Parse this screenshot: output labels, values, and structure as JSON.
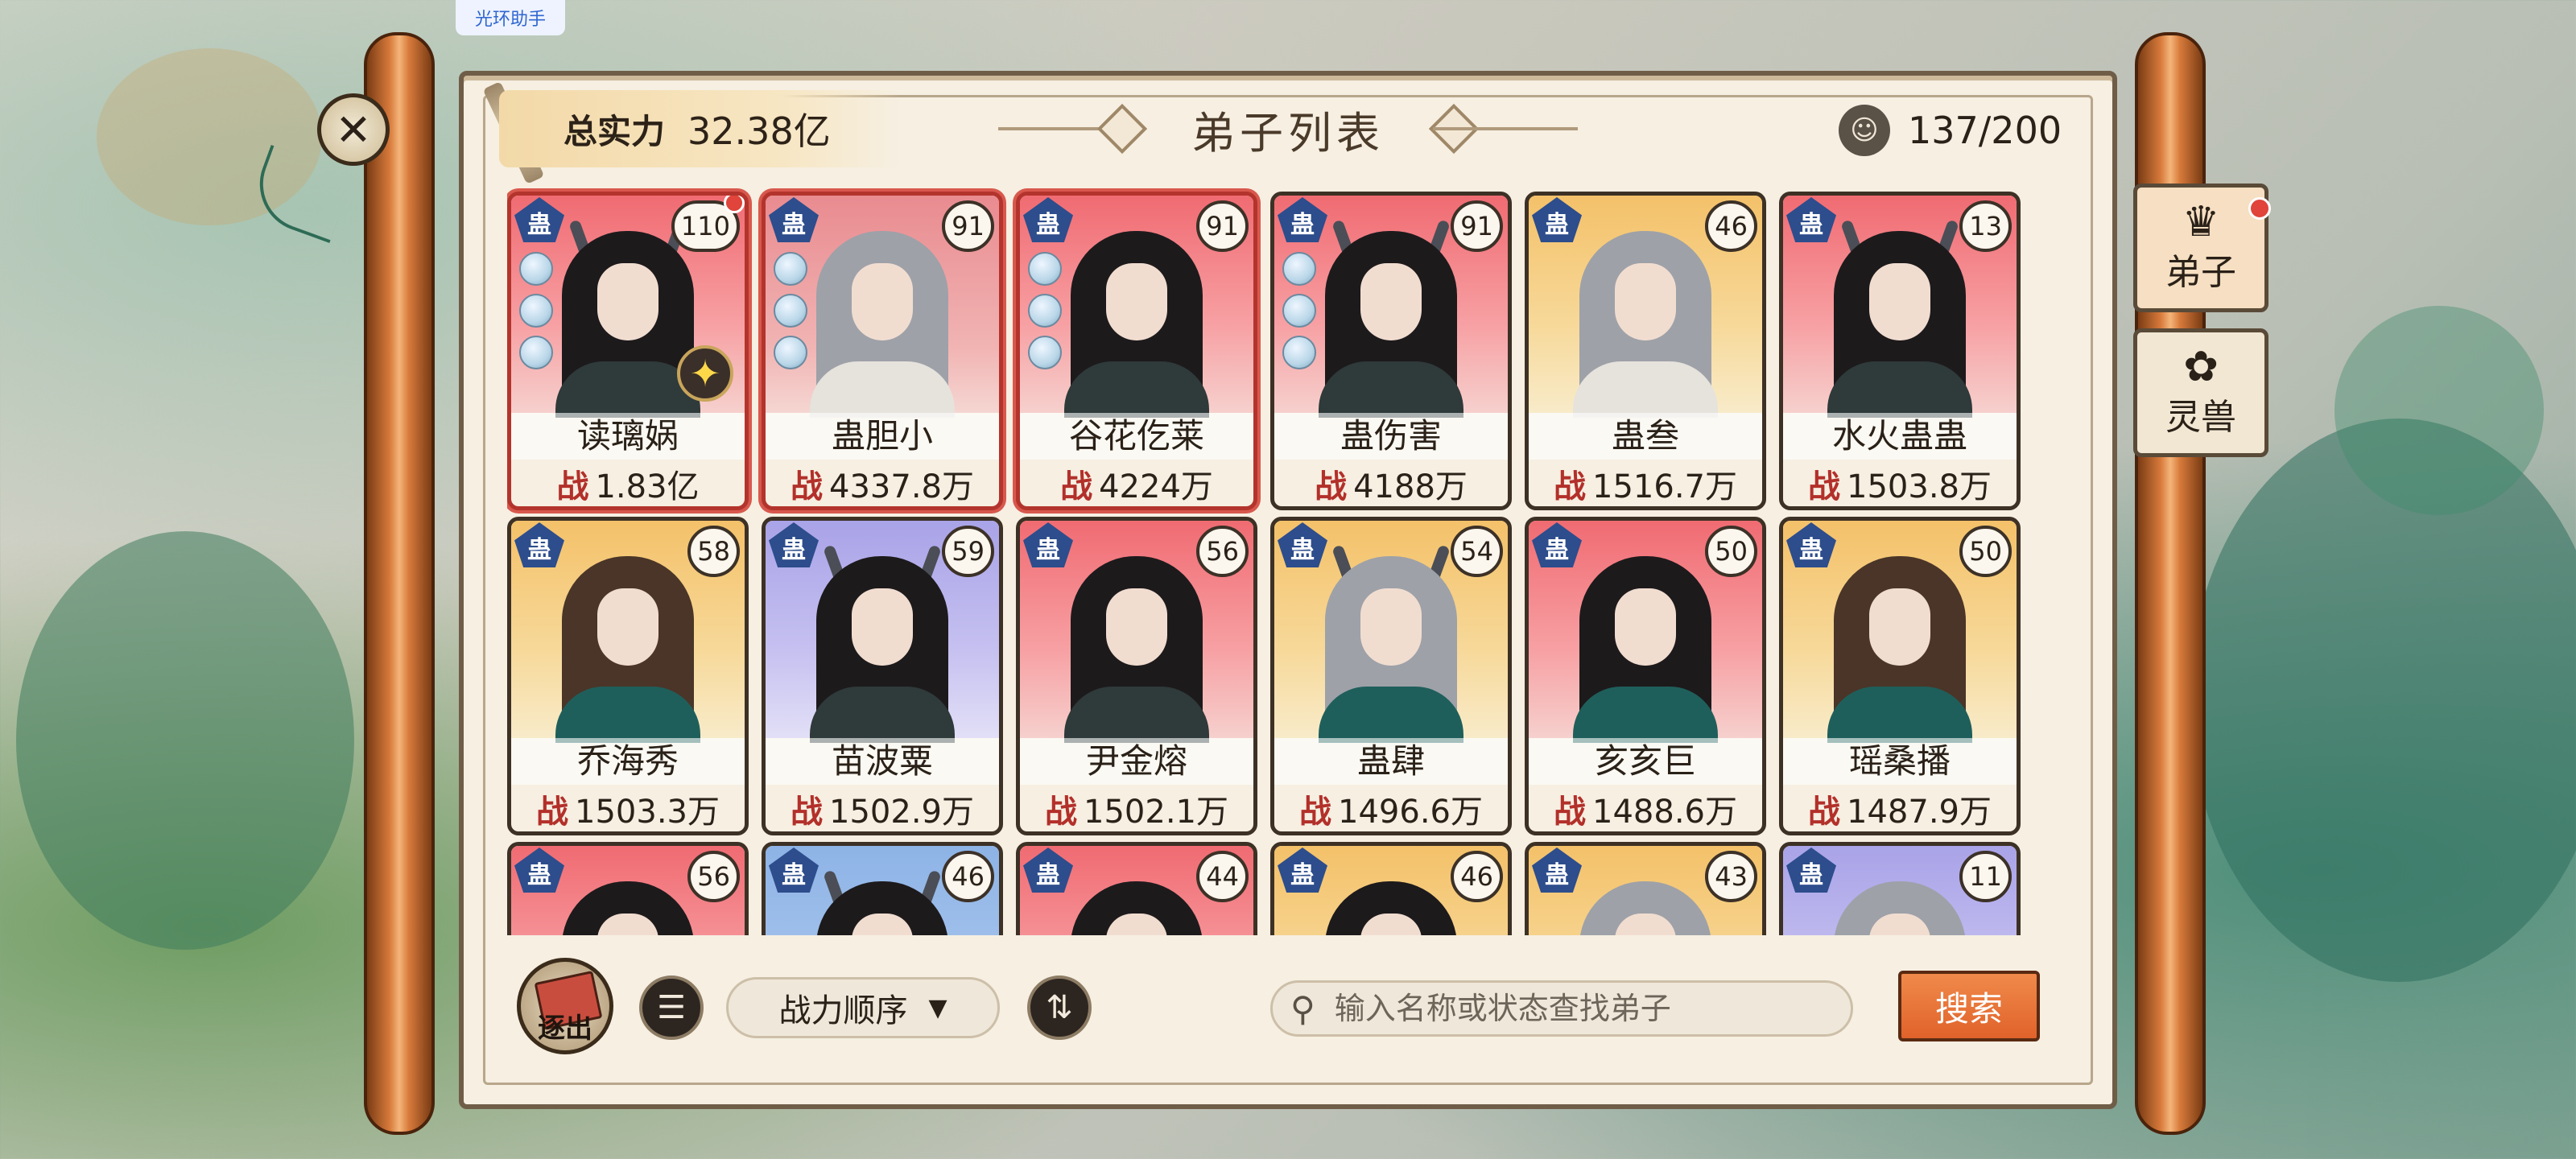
{
  "helper": {
    "label": "光环助手"
  },
  "header": {
    "total_label": "总实力",
    "total_value": "32.38亿",
    "title": "弟子列表",
    "count": "137/200"
  },
  "side_tabs": [
    {
      "label": "弟子",
      "icon": "disciple-icon",
      "active": true,
      "has_dot": true
    },
    {
      "label": "灵兽",
      "icon": "beast-icon",
      "active": false,
      "has_dot": false
    }
  ],
  "disciples": [
    {
      "name": "读璃娲",
      "power": "1.83亿",
      "level": "110",
      "badge": "蛊",
      "gems": 3,
      "special": true,
      "star": true,
      "dot": true,
      "bg": "red"
    },
    {
      "name": "蛊胆小",
      "power": "4337.8万",
      "level": "91",
      "badge": "蛊",
      "gems": 3,
      "special": true,
      "star": false,
      "dot": false,
      "bg": "gray"
    },
    {
      "name": "谷花仡莱",
      "power": "4224万",
      "level": "91",
      "badge": "蛊",
      "gems": 3,
      "special": true,
      "star": false,
      "dot": false,
      "bg": "red"
    },
    {
      "name": "蛊伤害",
      "power": "4188万",
      "level": "91",
      "badge": "蛊",
      "gems": 3,
      "special": false,
      "star": false,
      "dot": false,
      "bg": "red"
    },
    {
      "name": "蛊叁",
      "power": "1516.7万",
      "level": "46",
      "badge": "蛊",
      "gems": 0,
      "special": false,
      "star": false,
      "dot": false,
      "bg": "gold"
    },
    {
      "name": "水火蛊蛊",
      "power": "1503.8万",
      "level": "13",
      "badge": "蛊",
      "gems": 0,
      "special": false,
      "star": false,
      "dot": false,
      "bg": "red"
    },
    {
      "name": "乔海秀",
      "power": "1503.3万",
      "level": "58",
      "badge": "蛊",
      "gems": 0,
      "special": false,
      "star": false,
      "dot": false,
      "bg": "gold"
    },
    {
      "name": "苗波粟",
      "power": "1502.9万",
      "level": "59",
      "badge": "蛊",
      "gems": 0,
      "special": false,
      "star": false,
      "dot": false,
      "bg": "purple"
    },
    {
      "name": "尹金熔",
      "power": "1502.1万",
      "level": "56",
      "badge": "蛊",
      "gems": 0,
      "special": false,
      "star": false,
      "dot": false,
      "bg": "red"
    },
    {
      "name": "蛊肆",
      "power": "1496.6万",
      "level": "54",
      "badge": "蛊",
      "gems": 0,
      "special": false,
      "star": false,
      "dot": false,
      "bg": "gold"
    },
    {
      "name": "亥亥巨",
      "power": "1488.6万",
      "level": "50",
      "badge": "蛊",
      "gems": 0,
      "special": false,
      "star": false,
      "dot": false,
      "bg": "red"
    },
    {
      "name": "瑶桑播",
      "power": "1487.9万",
      "level": "50",
      "badge": "蛊",
      "gems": 0,
      "special": false,
      "star": false,
      "dot": false,
      "bg": "gold"
    },
    {
      "name": "",
      "power": "",
      "level": "56",
      "badge": "蛊",
      "gems": 0,
      "special": false,
      "star": false,
      "dot": false,
      "bg": "red"
    },
    {
      "name": "",
      "power": "",
      "level": "46",
      "badge": "蛊",
      "gems": 0,
      "special": false,
      "star": false,
      "dot": false,
      "bg": "blue"
    },
    {
      "name": "",
      "power": "",
      "level": "44",
      "badge": "蛊",
      "gems": 0,
      "special": false,
      "star": false,
      "dot": false,
      "bg": "red"
    },
    {
      "name": "",
      "power": "",
      "level": "46",
      "badge": "蛊",
      "gems": 0,
      "special": false,
      "star": false,
      "dot": false,
      "bg": "gold"
    },
    {
      "name": "",
      "power": "",
      "level": "43",
      "badge": "蛊",
      "gems": 0,
      "special": false,
      "star": false,
      "dot": false,
      "bg": "gold"
    },
    {
      "name": "",
      "power": "",
      "level": "11",
      "badge": "蛊",
      "gems": 0,
      "special": false,
      "star": false,
      "dot": false,
      "bg": "purple"
    }
  ],
  "power_prefix": "战",
  "footer": {
    "dismiss_label": "逐出",
    "sort_label": "战力顺序",
    "search_placeholder": "输入名称或状态查找弟子",
    "search_value": "",
    "search_button": "搜索"
  }
}
